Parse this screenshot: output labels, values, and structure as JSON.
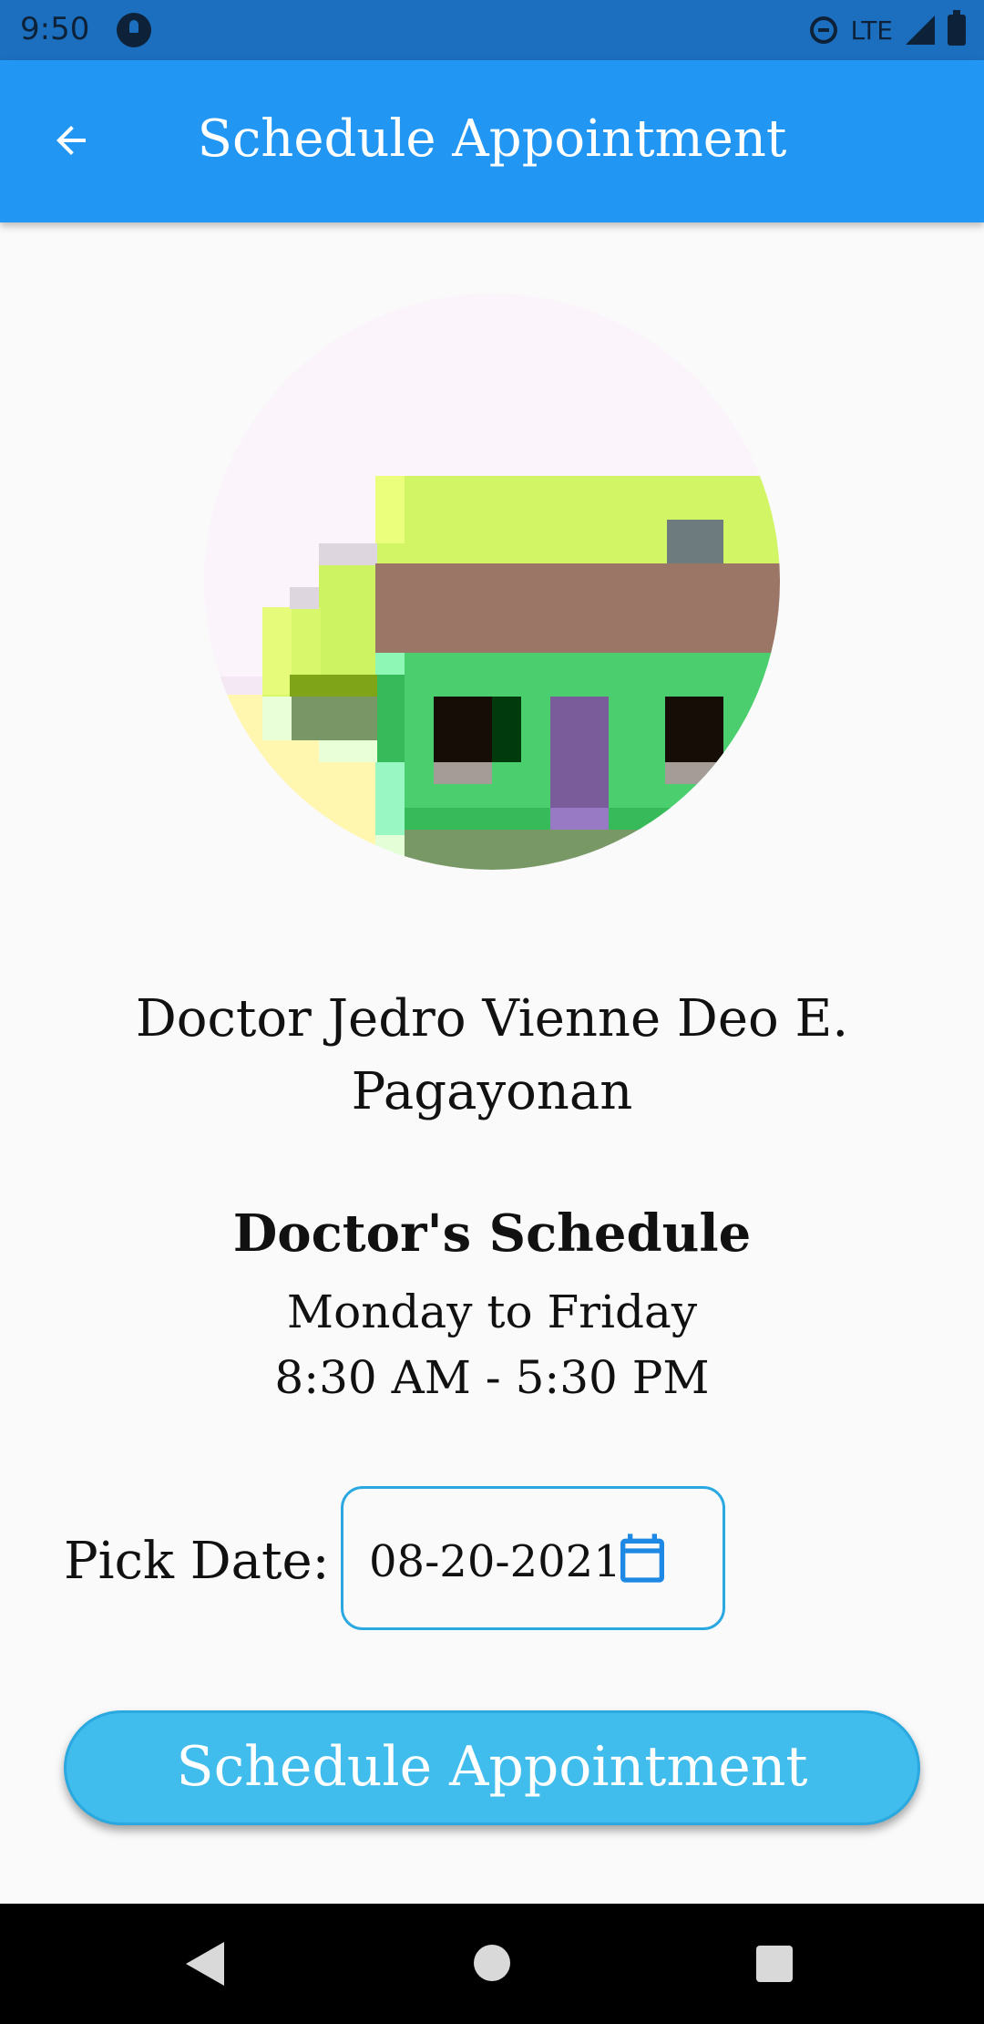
{
  "status_bar": {
    "time": "9:50",
    "network": "LTE",
    "icons": [
      "app-notification-icon",
      "do-not-disturb-icon",
      "signal-icon",
      "battery-icon"
    ]
  },
  "app_bar": {
    "title": "Schedule Appointment",
    "back_icon": "arrow-back-icon",
    "color": "#2196f3"
  },
  "doctor": {
    "name": "Doctor Jedro Vienne Deo E. Pagayonan",
    "avatar": "pixel-house-avatar"
  },
  "schedule": {
    "heading": "Doctor's Schedule",
    "days": "Monday to Friday",
    "hours": "8:30 AM - 5:30 PM"
  },
  "date_picker": {
    "label": "Pick Date:",
    "value": "08-20-2021",
    "icon": "calendar-icon"
  },
  "primary_action": {
    "label": "Schedule Appointment",
    "color": "#40bdec"
  },
  "nav_bar": {
    "icons": [
      "nav-back-icon",
      "nav-home-icon",
      "nav-recents-icon"
    ]
  }
}
